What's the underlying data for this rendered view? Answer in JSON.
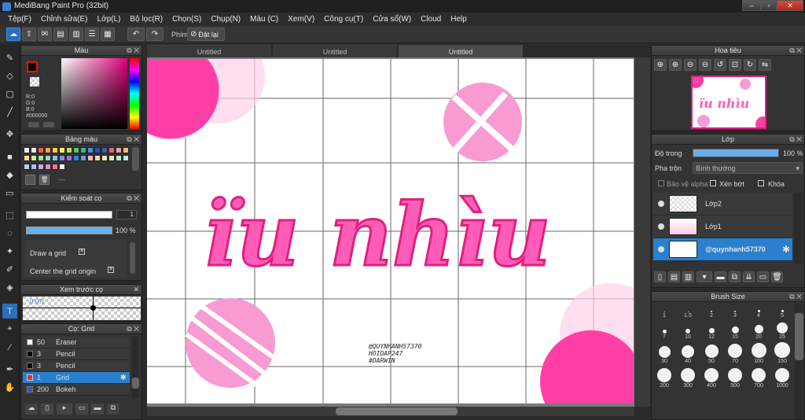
{
  "window": {
    "title": "MediBang Paint Pro (32bit)"
  },
  "menu": [
    "Tệp(F)",
    "Chỉnh sửa(E)",
    "Lớp(L)",
    "Bộ lọc(R)",
    "Chọn(S)",
    "Chụp(N)",
    "Màu (C)",
    "Xem(V)",
    "Công cụ(T)",
    "Cửa sổ(W)",
    "Cloud",
    "Help"
  ],
  "toolbar": {
    "snap_label": "Phím",
    "reset_label": "Đặt lại"
  },
  "tabs": [
    "Untitled",
    "Untitled",
    "Untitled"
  ],
  "color_panel": {
    "title": "Màu",
    "r": "R:0",
    "g": "G:0",
    "b": "B:0",
    "hex": "#000000",
    "primary": "#000000",
    "secondary": "#e8160c"
  },
  "palette_panel": {
    "title": "Bảng màu",
    "more": "---",
    "swatches": [
      "#f4f4f4",
      "#e8e8e8",
      "#f06040",
      "#f8a050",
      "#f8d040",
      "#fff060",
      "#b8e060",
      "#60c060",
      "#40b0a0",
      "#4090e0",
      "#2050c0",
      "#4060a0",
      "#f06060",
      "#f0a0a0",
      "#f0c070",
      "#f0e090",
      "#d0e890",
      "#a0e0a0",
      "#90d8d0",
      "#90c0f0",
      "#8090e0",
      "#a070d0",
      "#3080e0",
      "#60a0e0",
      "#f8b8b8",
      "#f8d8b8",
      "#f8e8b8",
      "#e0f0b8",
      "#c0e8c0",
      "#b8e8e8",
      "#b8d0f0",
      "#c0b8f0",
      "#d0a8e8",
      "#e090c0",
      "#f07090",
      "#f8f8f8"
    ]
  },
  "brush_control": {
    "title": "Kiểm soát cọ",
    "size_value": "1",
    "opacity_value": "100 %",
    "opt1": "Draw a grid",
    "opt2": "Center the grid origin"
  },
  "preview_panel": {
    "title": "Xem trước cọ",
    "size_label": "0.07t"
  },
  "brush_list": {
    "title": "Cọ: Grid",
    "items": [
      {
        "size": "50",
        "name": "Eraser",
        "color": "#ffffff"
      },
      {
        "size": "3",
        "name": "Pencil",
        "color": "#000000"
      },
      {
        "size": "3",
        "name": "Pencil",
        "color": "#000000"
      },
      {
        "size": "1",
        "name": "Grid",
        "color": "#e03030"
      },
      {
        "size": "200",
        "name": "Bokeh",
        "color": "#3050e0"
      }
    ]
  },
  "canvas": {
    "headline": "ïu nhìu",
    "credits": [
      "@QUYNHANH57370",
      "HOIDAP247",
      "#DARWIN"
    ]
  },
  "navigator": {
    "title": "Hoa tiêu",
    "thumb_text": "ïu nhìu"
  },
  "layers": {
    "title": "Lớp",
    "opacity_label": "Độ trong",
    "opacity_value": "100 %",
    "opacity_fraction": 1.0,
    "blend_label": "Pha trộn",
    "blend_value": "Bình thường",
    "protect_alpha": "Bảo vệ alpha",
    "clipping": "Xén bớt",
    "lock": "Khóa",
    "rows": [
      "Lớp2",
      "Lớp1",
      "@quynhanh57370"
    ]
  },
  "brush_size": {
    "title": "Brush Size",
    "sizes": [
      "1",
      "1.5",
      "2",
      "3",
      "4",
      "5",
      "7",
      "10",
      "12",
      "15",
      "20",
      "25",
      "30",
      "40",
      "50",
      "70",
      "100",
      "150",
      "200",
      "300",
      "400",
      "500",
      "700",
      "1000"
    ]
  }
}
